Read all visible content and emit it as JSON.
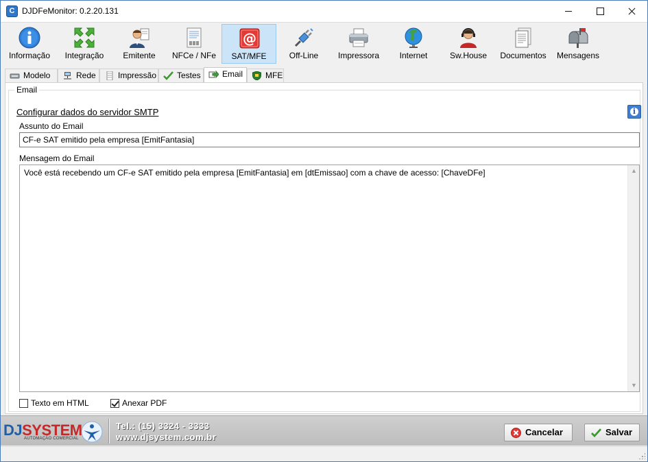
{
  "window": {
    "title": "DJDFeMonitor: 0.2.20.131"
  },
  "toolbar": {
    "items": [
      {
        "label": "Informação",
        "icon": "info-icon",
        "active": false
      },
      {
        "label": "Integração",
        "icon": "integration-arrows-icon",
        "active": false
      },
      {
        "label": "Emitente",
        "icon": "person-icon",
        "active": false
      },
      {
        "label": "NFCe / NFe",
        "icon": "document-barcode-icon",
        "active": false
      },
      {
        "label": "SAT/MFE",
        "icon": "at-sign-icon",
        "active": true
      },
      {
        "label": "Off-Line",
        "icon": "plug-icon",
        "active": false
      },
      {
        "label": "Impressora",
        "icon": "printer-icon",
        "active": false
      },
      {
        "label": "Internet",
        "icon": "globe-icon",
        "active": false
      },
      {
        "label": "Sw.House",
        "icon": "headset-person-icon",
        "active": false
      },
      {
        "label": "Documentos",
        "icon": "documents-icon",
        "active": false
      },
      {
        "label": "Mensagens",
        "icon": "mailbox-icon",
        "active": false
      }
    ]
  },
  "tabs": [
    {
      "label": "Modelo",
      "icon": "device-icon",
      "active": false
    },
    {
      "label": "Rede",
      "icon": "network-icon",
      "active": false
    },
    {
      "label": "Impressão",
      "icon": "receipt-icon",
      "active": false
    },
    {
      "label": "Testes",
      "icon": "checkmark-icon",
      "active": false
    },
    {
      "label": "Email",
      "icon": "send-arrow-icon",
      "active": true
    },
    {
      "label": "MFE",
      "icon": "shield-icon",
      "active": false
    }
  ],
  "email": {
    "group_title": "Email",
    "smtp_link": "Configurar dados do servidor SMTP",
    "subject_label": "Assunto do Email",
    "subject_value": "CF-e SAT emitido pela empresa [EmitFantasia]",
    "message_label": "Mensagem do Email",
    "message_value": "Você está recebendo um CF-e SAT emitido pela empresa [EmitFantasia] em [dtEmissao] com a chave de acesso: [ChaveDFe]",
    "html_checkbox_label": "Texto em HTML",
    "html_checked": false,
    "pdf_checkbox_label": "Anexar PDF",
    "pdf_checked": true
  },
  "footer": {
    "brand_prefix": "DJ",
    "brand_suffix": "SYSTEM",
    "brand_tagline": "AUTOMAÇÃO COMERCIAL",
    "phone": "Tel.: (15) 3324 - 3333",
    "website": "www.djsystem.com.br",
    "cancel_label": "Cancelar",
    "save_label": "Salvar"
  },
  "colors": {
    "accent": "#2f78c9",
    "active_tool_bg": "#cce4f7",
    "brand_blue": "#1f5fa8",
    "brand_red": "#c62828"
  }
}
